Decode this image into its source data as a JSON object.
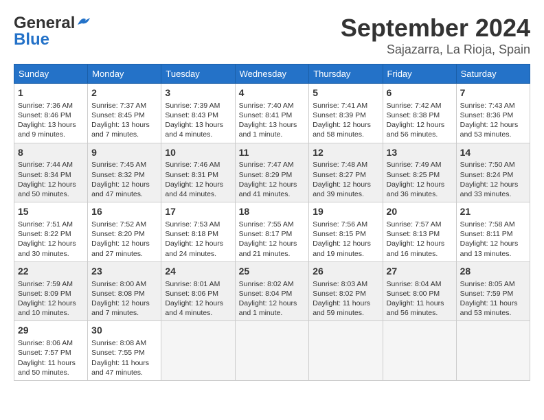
{
  "header": {
    "logo_line1": "General",
    "logo_line2": "Blue",
    "month": "September 2024",
    "location": "Sajazarra, La Rioja, Spain"
  },
  "weekdays": [
    "Sunday",
    "Monday",
    "Tuesday",
    "Wednesday",
    "Thursday",
    "Friday",
    "Saturday"
  ],
  "weeks": [
    [
      {
        "day": "1",
        "sunrise": "7:36 AM",
        "sunset": "8:46 PM",
        "daylight": "13 hours and 9 minutes."
      },
      {
        "day": "2",
        "sunrise": "7:37 AM",
        "sunset": "8:45 PM",
        "daylight": "13 hours and 7 minutes."
      },
      {
        "day": "3",
        "sunrise": "7:39 AM",
        "sunset": "8:43 PM",
        "daylight": "13 hours and 4 minutes."
      },
      {
        "day": "4",
        "sunrise": "7:40 AM",
        "sunset": "8:41 PM",
        "daylight": "13 hours and 1 minute."
      },
      {
        "day": "5",
        "sunrise": "7:41 AM",
        "sunset": "8:39 PM",
        "daylight": "12 hours and 58 minutes."
      },
      {
        "day": "6",
        "sunrise": "7:42 AM",
        "sunset": "8:38 PM",
        "daylight": "12 hours and 56 minutes."
      },
      {
        "day": "7",
        "sunrise": "7:43 AM",
        "sunset": "8:36 PM",
        "daylight": "12 hours and 53 minutes."
      }
    ],
    [
      {
        "day": "8",
        "sunrise": "7:44 AM",
        "sunset": "8:34 PM",
        "daylight": "12 hours and 50 minutes."
      },
      {
        "day": "9",
        "sunrise": "7:45 AM",
        "sunset": "8:32 PM",
        "daylight": "12 hours and 47 minutes."
      },
      {
        "day": "10",
        "sunrise": "7:46 AM",
        "sunset": "8:31 PM",
        "daylight": "12 hours and 44 minutes."
      },
      {
        "day": "11",
        "sunrise": "7:47 AM",
        "sunset": "8:29 PM",
        "daylight": "12 hours and 41 minutes."
      },
      {
        "day": "12",
        "sunrise": "7:48 AM",
        "sunset": "8:27 PM",
        "daylight": "12 hours and 39 minutes."
      },
      {
        "day": "13",
        "sunrise": "7:49 AM",
        "sunset": "8:25 PM",
        "daylight": "12 hours and 36 minutes."
      },
      {
        "day": "14",
        "sunrise": "7:50 AM",
        "sunset": "8:24 PM",
        "daylight": "12 hours and 33 minutes."
      }
    ],
    [
      {
        "day": "15",
        "sunrise": "7:51 AM",
        "sunset": "8:22 PM",
        "daylight": "12 hours and 30 minutes."
      },
      {
        "day": "16",
        "sunrise": "7:52 AM",
        "sunset": "8:20 PM",
        "daylight": "12 hours and 27 minutes."
      },
      {
        "day": "17",
        "sunrise": "7:53 AM",
        "sunset": "8:18 PM",
        "daylight": "12 hours and 24 minutes."
      },
      {
        "day": "18",
        "sunrise": "7:55 AM",
        "sunset": "8:17 PM",
        "daylight": "12 hours and 21 minutes."
      },
      {
        "day": "19",
        "sunrise": "7:56 AM",
        "sunset": "8:15 PM",
        "daylight": "12 hours and 19 minutes."
      },
      {
        "day": "20",
        "sunrise": "7:57 AM",
        "sunset": "8:13 PM",
        "daylight": "12 hours and 16 minutes."
      },
      {
        "day": "21",
        "sunrise": "7:58 AM",
        "sunset": "8:11 PM",
        "daylight": "12 hours and 13 minutes."
      }
    ],
    [
      {
        "day": "22",
        "sunrise": "7:59 AM",
        "sunset": "8:09 PM",
        "daylight": "12 hours and 10 minutes."
      },
      {
        "day": "23",
        "sunrise": "8:00 AM",
        "sunset": "8:08 PM",
        "daylight": "12 hours and 7 minutes."
      },
      {
        "day": "24",
        "sunrise": "8:01 AM",
        "sunset": "8:06 PM",
        "daylight": "12 hours and 4 minutes."
      },
      {
        "day": "25",
        "sunrise": "8:02 AM",
        "sunset": "8:04 PM",
        "daylight": "12 hours and 1 minute."
      },
      {
        "day": "26",
        "sunrise": "8:03 AM",
        "sunset": "8:02 PM",
        "daylight": "11 hours and 59 minutes."
      },
      {
        "day": "27",
        "sunrise": "8:04 AM",
        "sunset": "8:00 PM",
        "daylight": "11 hours and 56 minutes."
      },
      {
        "day": "28",
        "sunrise": "8:05 AM",
        "sunset": "7:59 PM",
        "daylight": "11 hours and 53 minutes."
      }
    ],
    [
      {
        "day": "29",
        "sunrise": "8:06 AM",
        "sunset": "7:57 PM",
        "daylight": "11 hours and 50 minutes."
      },
      {
        "day": "30",
        "sunrise": "8:08 AM",
        "sunset": "7:55 PM",
        "daylight": "11 hours and 47 minutes."
      },
      null,
      null,
      null,
      null,
      null
    ]
  ]
}
